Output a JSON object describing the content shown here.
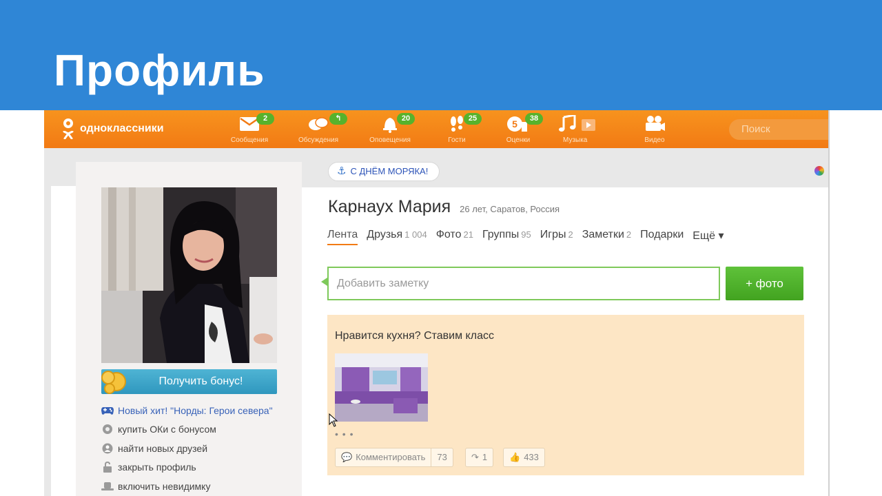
{
  "slide": {
    "title": "Профиль"
  },
  "brand": {
    "logo_text": "одноклассники",
    "accent": "#f27a14",
    "header_blue": "#2f86d6"
  },
  "nav": {
    "items": [
      {
        "label": "Сообщения",
        "badge": "2",
        "icon": "envelope-icon"
      },
      {
        "label": "Обсуждения",
        "badge": "↰",
        "icon": "chat-bubbles-icon"
      },
      {
        "label": "Оповещения",
        "badge": "20",
        "icon": "bell-icon"
      },
      {
        "label": "Гости",
        "badge": "25",
        "icon": "footprints-icon"
      },
      {
        "label": "Оценки",
        "badge": "38",
        "icon": "rating-icon"
      },
      {
        "label": "Музыка",
        "badge": "",
        "icon": "music-note-icon"
      },
      {
        "label": "Видео",
        "badge": "",
        "icon": "video-camera-icon"
      }
    ],
    "search_placeholder": "Поиск"
  },
  "holiday_badge": "С ДНЁМ МОРЯКА!",
  "profile": {
    "name": "Карнаух Мария",
    "meta": "26 лет, Саратов, Россия"
  },
  "tabs": [
    {
      "label": "Лента",
      "count": ""
    },
    {
      "label": "Друзья",
      "count": "1 004"
    },
    {
      "label": "Фото",
      "count": "21"
    },
    {
      "label": "Группы",
      "count": "95"
    },
    {
      "label": "Игры",
      "count": "2"
    },
    {
      "label": "Заметки",
      "count": "2"
    },
    {
      "label": "Подарки",
      "count": ""
    },
    {
      "label": "Ещё ▾",
      "count": ""
    }
  ],
  "note": {
    "placeholder": "Добавить заметку",
    "photo_button": "+ фото"
  },
  "sidebar": {
    "bonus_button": "Получить бонус!",
    "links": [
      {
        "label": "Новый хит! \"Норды: Герои севера\"",
        "icon": "gamepad-icon"
      },
      {
        "label": "купить ОКи с бонусом",
        "icon": "coin-icon"
      },
      {
        "label": "найти новых друзей",
        "icon": "person-icon"
      },
      {
        "label": "закрыть профиль",
        "icon": "lock-icon"
      },
      {
        "label": "включить невидимку",
        "icon": "hat-icon"
      }
    ]
  },
  "post": {
    "text": "Нравится кухня? Ставим класс",
    "dots": "• • •",
    "comment_label": "Комментировать",
    "comment_count": "73",
    "share_count": "1",
    "like_count": "433"
  }
}
